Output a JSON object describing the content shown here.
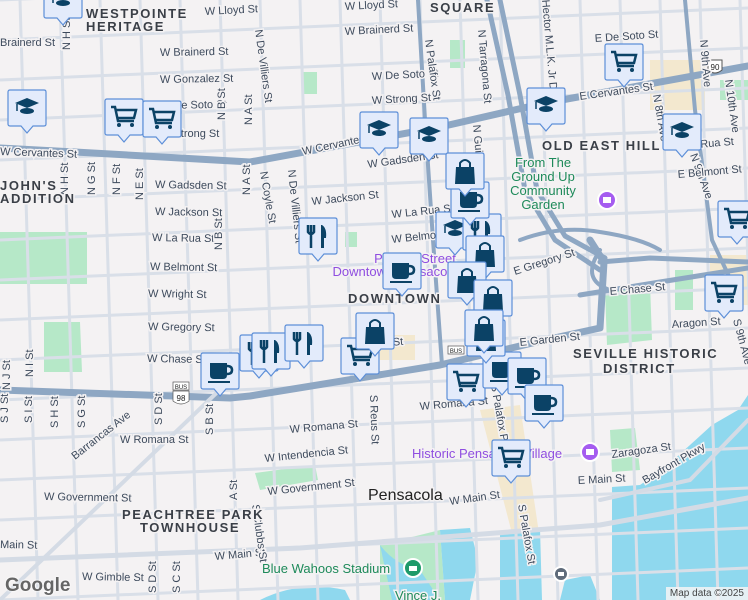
{
  "colors": {
    "marker_fill": "#e3ebfb",
    "marker_border": "#5d8fd8",
    "icon": "#0b4266",
    "major_road": "#8ea7c3",
    "water": "#8fd8ee",
    "park": "#b6e8c8",
    "museum": "#a55cf0"
  },
  "labels": {
    "streets": [
      "W Lloyd St",
      "W Lloyd St",
      "Brainerd St",
      "W Brainerd St",
      "W Brainerd St",
      "W Gonzalez St",
      "W De Soto St",
      "W De Soto St",
      "E De Soto St",
      "W Strong St",
      "W Strong St",
      "W Cervantes St",
      "W Cervantes St",
      "E Cervantes St",
      "W Gadsden St",
      "W Gadsden St",
      "W Jackson St",
      "W Jackson St",
      "W La Rua St",
      "W La Rua St",
      "W Belmont St",
      "W Belmont St",
      "W Wright St",
      "W Gregory St",
      "E Gregory St",
      "W Chase St",
      "W Chase St",
      "E Chase St",
      "E Garden St",
      "Aragon St",
      "W Romana St",
      "W Romana St",
      "W Romana St",
      "W Intendencia St",
      "W Government St",
      "W Government St",
      "Main St",
      "W Main St",
      "W Main St",
      "E Main St",
      "W Gimble St",
      "Zaragoza St",
      "Bayfront Pkwy",
      "Barrancas Ave",
      "N Palafox St",
      "N Tarragona St",
      "N De Villiers St",
      "N De Villiers St",
      "N Coyle St",
      "N A St",
      "N A St",
      "N B St",
      "N B St",
      "N E St",
      "N F St",
      "N G St",
      "N H St",
      "N H St",
      "N Guillemard St",
      "N 9th Ave",
      "N 9th Ave",
      "N 8th Ave",
      "N 10th Ave",
      "S 9th Ave",
      "S Palafox St",
      "S Reus St",
      "S B St",
      "S D St",
      "S D St",
      "S C St",
      "S G St",
      "S H St",
      "S I St",
      "S J St",
      "A St",
      "S Clubbs St",
      "N J St",
      "N I St",
      "S Palafox Pl",
      "Hector M.L.K. Jr Dr",
      "E La Rua St",
      "E Belmont St"
    ],
    "neighborhoods": [
      "WESTPOINTE",
      "HERITAGE",
      "SQUARE",
      "OLD EAST HILL",
      "DOWNTOWN",
      "SEVILLE HISTORIC",
      "DISTRICT",
      "PEACHTREE PARK",
      "TOWNHOUSE",
      "JOHN'S",
      "ADDITION"
    ],
    "city": "Pensacola",
    "pois": {
      "garden": [
        "From The",
        "Ground Up",
        "Community",
        "Garden"
      ],
      "palafox": [
        "Palafox Street",
        "Downtown Pensacola"
      ],
      "village": "Historic Pensacola Village",
      "stadium": "Blue Wahoos Stadium",
      "vince": "Vince J."
    },
    "shields": {
      "us90": "90",
      "bus98": "98",
      "bus": "BUS"
    }
  },
  "markers": [
    {
      "icon": "education"
    },
    {
      "icon": "education"
    },
    {
      "icon": "education"
    },
    {
      "icon": "education"
    },
    {
      "icon": "education"
    },
    {
      "icon": "education"
    },
    {
      "icon": "education"
    },
    {
      "icon": "cart"
    },
    {
      "icon": "cart"
    },
    {
      "icon": "cart"
    },
    {
      "icon": "cart"
    },
    {
      "icon": "cart"
    },
    {
      "icon": "cart"
    },
    {
      "icon": "cart"
    },
    {
      "icon": "cart"
    },
    {
      "icon": "restaurant"
    },
    {
      "icon": "restaurant"
    },
    {
      "icon": "restaurant"
    },
    {
      "icon": "restaurant"
    },
    {
      "icon": "restaurant"
    },
    {
      "icon": "coffee"
    },
    {
      "icon": "coffee"
    },
    {
      "icon": "coffee"
    },
    {
      "icon": "coffee"
    },
    {
      "icon": "coffee"
    },
    {
      "icon": "coffee"
    },
    {
      "icon": "shopping"
    },
    {
      "icon": "shopping"
    },
    {
      "icon": "shopping"
    },
    {
      "icon": "shopping"
    },
    {
      "icon": "shopping"
    },
    {
      "icon": "shopping"
    },
    {
      "icon": "shopping"
    }
  ],
  "footer": {
    "logo": "Google",
    "attribution": "Map data ©2025"
  }
}
